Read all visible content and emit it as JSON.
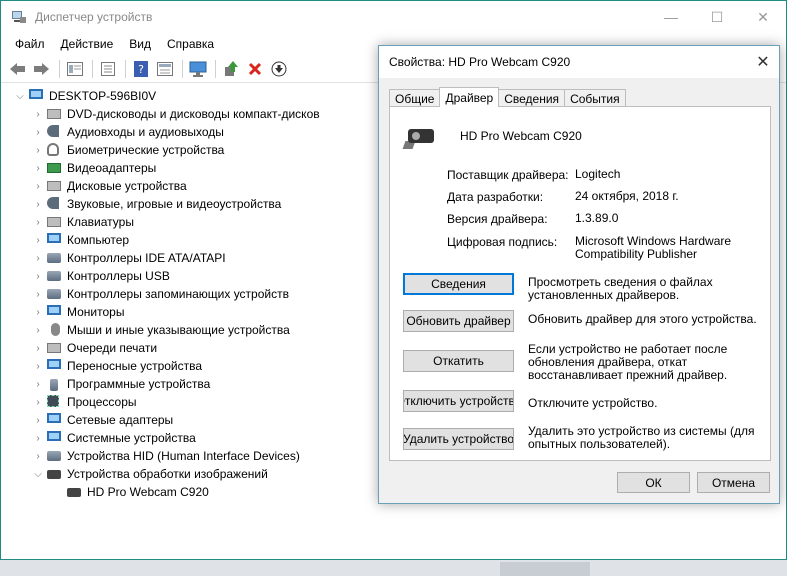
{
  "window": {
    "title": "Диспетчер устройств",
    "controls": {
      "minimize": "—",
      "maximize": "☐",
      "close": "✕"
    }
  },
  "menu": [
    "Файл",
    "Действие",
    "Вид",
    "Справка"
  ],
  "toolbar": {
    "icons": [
      "back-arrow-icon",
      "forward-arrow-icon",
      "show-hide-tree-icon",
      "properties-icon",
      "help-icon",
      "view-icon",
      "monitor-scan-icon",
      "update-driver-icon",
      "remove-device-icon",
      "download-icon"
    ],
    "colors": {
      "remove": "#d9261c",
      "update": "#3a9a3a"
    }
  },
  "tree": {
    "root": "DESKTOP-596BI0V",
    "categories": [
      "DVD-дисководы и дисководы компакт-дисков",
      "Аудиовходы и аудиовыходы",
      "Биометрические устройства",
      "Видеоадаптеры",
      "Дисковые устройства",
      "Звуковые, игровые и видеоустройства",
      "Клавиатуры",
      "Компьютер",
      "Контроллеры IDE ATA/ATAPI",
      "Контроллеры USB",
      "Контроллеры запоминающих устройств",
      "Мониторы",
      "Мыши и иные указывающие устройства",
      "Очереди печати",
      "Переносные устройства",
      "Программные устройства",
      "Процессоры",
      "Сетевые адаптеры",
      "Системные устройства",
      "Устройства HID (Human Interface Devices)",
      "Устройства обработки изображений"
    ],
    "expanded_device": "HD Pro Webcam C920"
  },
  "dialog": {
    "title": "Свойства: HD Pro Webcam C920",
    "close": "✕",
    "tabs": [
      "Общие",
      "Драйвер",
      "Сведения",
      "События"
    ],
    "active_tab": "Драйвер",
    "device_name": "HD Pro Webcam C920",
    "info": {
      "provider_label": "Поставщик драйвера:",
      "provider": "Logitech",
      "date_label": "Дата разработки:",
      "date": "24 октября, 2018 г.",
      "version_label": "Версия драйвера:",
      "version": "1.3.89.0",
      "signature_label": "Цифровая подпись:",
      "signature_line1": "Microsoft Windows Hardware",
      "signature_line2": "Compatibility Publisher"
    },
    "actions": [
      {
        "label": "Сведения",
        "desc": "Просмотреть сведения о файлах установленных драйверов."
      },
      {
        "label": "Обновить драйвер",
        "desc": "Обновить драйвер для этого устройства."
      },
      {
        "label": "Откатить",
        "desc": "Если устройство не работает после обновления драйвера, откат восстанавливает прежний драйвер."
      },
      {
        "label": "Отключить устройство",
        "desc": "Отключите устройство."
      },
      {
        "label": "Удалить устройство",
        "desc": "Удалить это устройство из системы (для опытных пользователей)."
      }
    ],
    "ok": "ОК",
    "cancel": "Отмена"
  }
}
